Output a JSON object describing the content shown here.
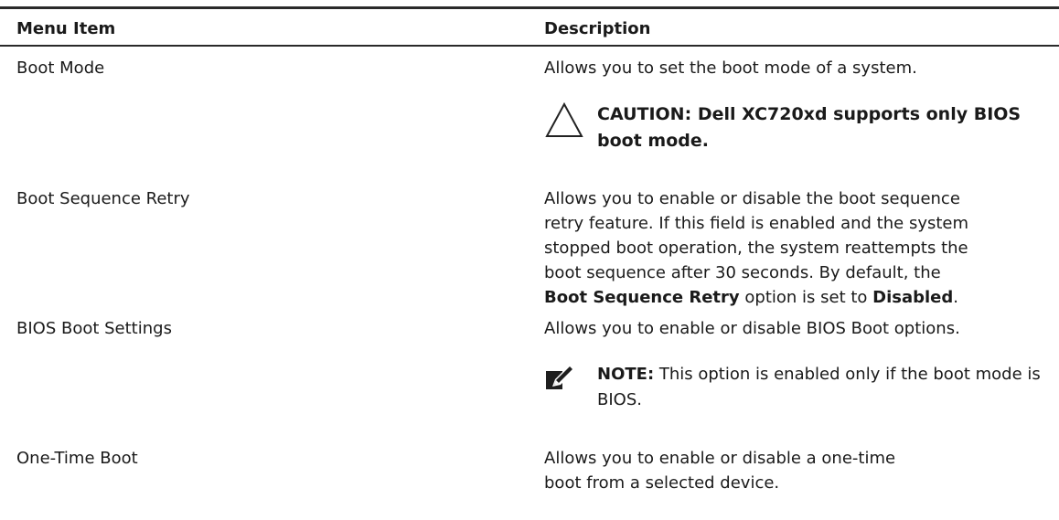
{
  "table": {
    "headers": {
      "menu_item": "Menu Item",
      "description": "Description"
    },
    "rows": [
      {
        "menu_item": "Boot Mode",
        "description": "Allows you to set the boot mode of a system.",
        "caution": {
          "label": "CAUTION:",
          "text": "Dell XC720xd supports only BIOS boot mode."
        }
      },
      {
        "menu_item": "Boot Sequence Retry",
        "description_parts": {
          "line1": "Allows you to enable or disable the boot sequence",
          "line2": "retry feature. If this field is enabled and the system",
          "line3": "stopped boot operation, the system reattempts the",
          "line4": "boot sequence after 30 seconds. By default, the",
          "bold_option": "Boot Sequence Retry",
          "mid": " option is set to ",
          "bold_value": "Disabled",
          "end": "."
        }
      },
      {
        "menu_item": "BIOS Boot Settings",
        "description": "Allows you to enable or disable BIOS Boot options.",
        "note": {
          "label": "NOTE:",
          "text": " This option is enabled only if the boot mode is BIOS."
        }
      },
      {
        "menu_item": "One-Time Boot",
        "description": "Allows you to enable or disable a one-time boot from a selected device."
      }
    ]
  },
  "icons": {
    "caution": "warning-triangle-icon",
    "note": "note-pencil-icon"
  }
}
